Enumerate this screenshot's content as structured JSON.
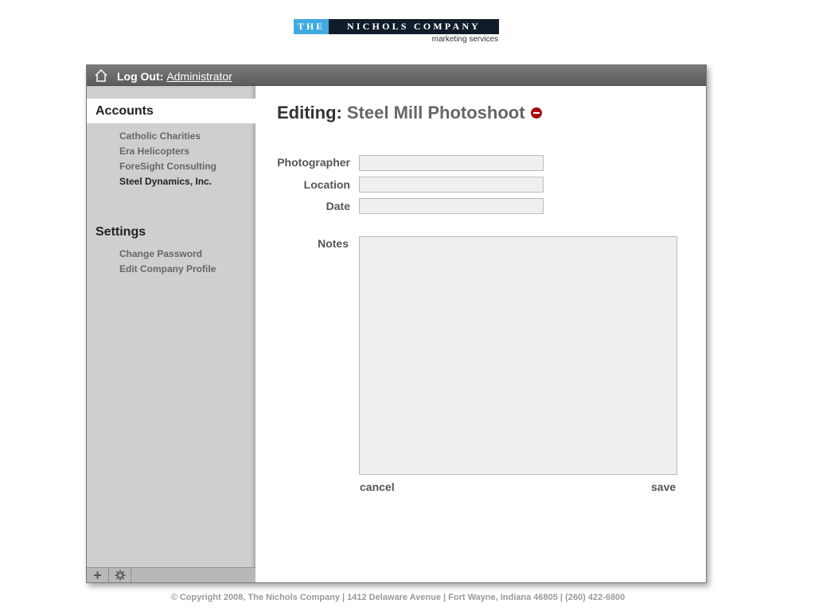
{
  "logo": {
    "word_the": "THE",
    "word_name": "NICHOLS COMPANY",
    "tagline": "marketing services"
  },
  "titlebar": {
    "home_icon": "home-icon",
    "logout_label": "Log Out:",
    "user": "Administrator"
  },
  "sidebar": {
    "accounts_title": "Accounts",
    "accounts": [
      {
        "label": "Catholic Charities",
        "active": false
      },
      {
        "label": "Era Helicopters",
        "active": false
      },
      {
        "label": "ForeSight Consulting",
        "active": false
      },
      {
        "label": "Steel Dynamics, Inc.",
        "active": true
      }
    ],
    "settings_title": "Settings",
    "settings": [
      {
        "label": "Change Password"
      },
      {
        "label": "Edit Company Profile"
      }
    ],
    "footer": {
      "add_label": "+",
      "add_icon": "plus-icon",
      "settings_icon": "gear-icon"
    }
  },
  "editor": {
    "prefix": "Editing:",
    "name": "Steel Mill Photoshoot",
    "delete_icon": "delete-icon",
    "fields": {
      "photographer_label": "Photographer",
      "photographer_value": "",
      "location_label": "Location",
      "location_value": "",
      "date_label": "Date",
      "date_value": "",
      "notes_label": "Notes",
      "notes_value": ""
    },
    "cancel_label": "cancel",
    "save_label": "save"
  },
  "footer": {
    "copyright": "© Copyright 2008, The Nichols Company | 1412 Delaware Avenue | Fort Wayne, Indiana 46805 | (260) 422-6800"
  },
  "colors": {
    "logo_blue": "#3fa9e0",
    "logo_navy": "#111c2a",
    "titlebar": "#6b6b6b",
    "sidebar": "#cfcfcf",
    "field_bg": "#efefef",
    "delete_red": "#a50f0f"
  }
}
